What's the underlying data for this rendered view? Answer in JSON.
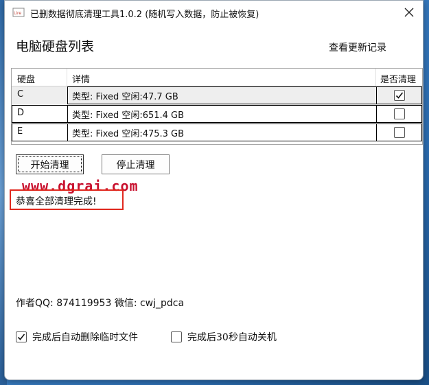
{
  "window": {
    "title": "已删数据彻底清理工具1.0.2 (随机写入数据，防止被恢复)"
  },
  "header": {
    "heading": "电脑硬盘列表",
    "update_link": "查看更新记录"
  },
  "table": {
    "columns": [
      "硬盘",
      "详情",
      "是否清理"
    ],
    "rows": [
      {
        "drive": "C",
        "detail": "类型: Fixed 空闲:47.7 GB",
        "checked": true
      },
      {
        "drive": "D",
        "detail": "类型: Fixed 空闲:651.4 GB",
        "checked": false
      },
      {
        "drive": "E",
        "detail": "类型: Fixed 空闲:475.3 GB",
        "checked": false
      }
    ]
  },
  "actions": {
    "start_label": "开始清理",
    "stop_label": "停止清理"
  },
  "watermark": "www.dgrai.com",
  "status": "恭喜全部清理完成!",
  "author": "作者QQ: 874119953   微信: cwj_pdca",
  "options": {
    "delete_temp_label": "完成后自动删除临时文件",
    "delete_temp_checked": true,
    "shutdown_label": "完成后30秒自动关机",
    "shutdown_checked": false
  }
}
